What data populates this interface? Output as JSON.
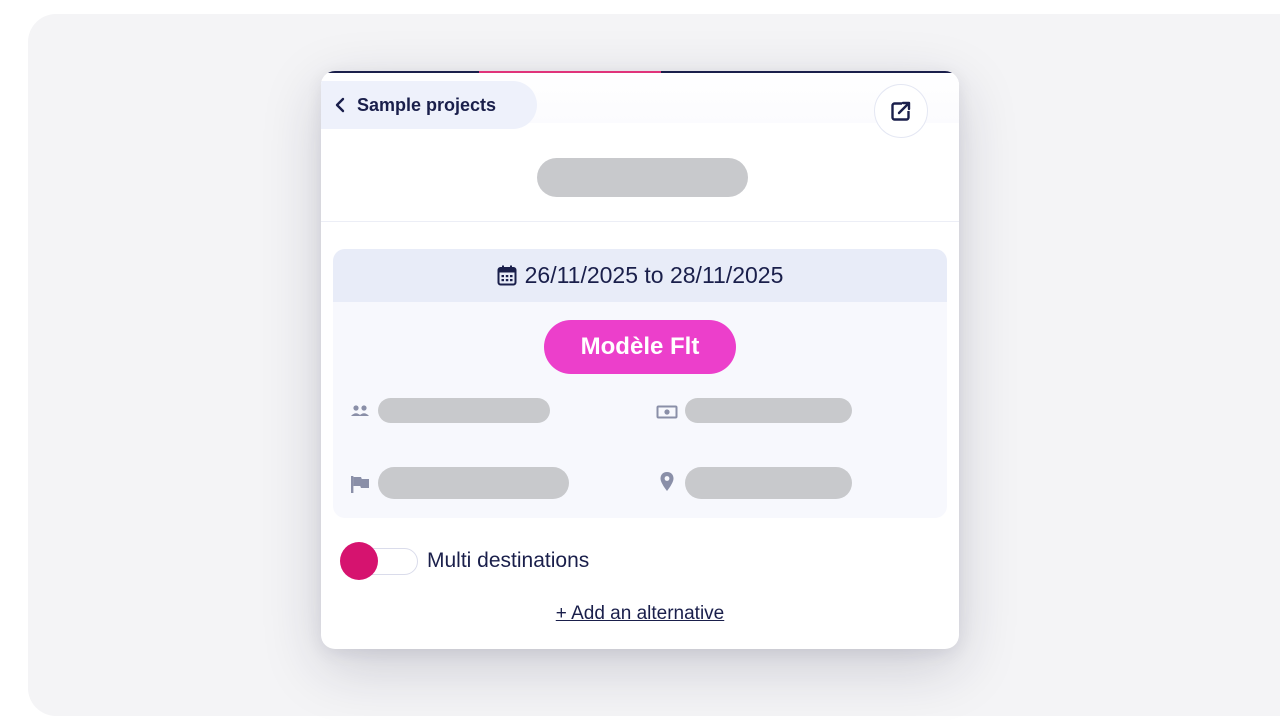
{
  "header": {
    "back_label": "Sample projects",
    "external_icon": "external-link-icon",
    "back_icon": "chevron-left-icon"
  },
  "details": {
    "date_icon": "calendar-icon",
    "date_range": "26/11/2025 to 28/11/2025",
    "tag_label": "Modèle Flt",
    "info_icons": [
      "people-icon",
      "money-icon",
      "flag-icon",
      "location-pin-icon"
    ]
  },
  "multi_destinations": {
    "label": "Multi destinations",
    "enabled": false
  },
  "add_alternative_label": "+ Add an alternative",
  "colors": {
    "navy": "#1a1f4b",
    "tag_pink": "#ec3fcb",
    "toggle_knob": "#d6136f",
    "placeholder_gray": "#c8c9cc",
    "icon_gray": "#8a8fa8"
  }
}
